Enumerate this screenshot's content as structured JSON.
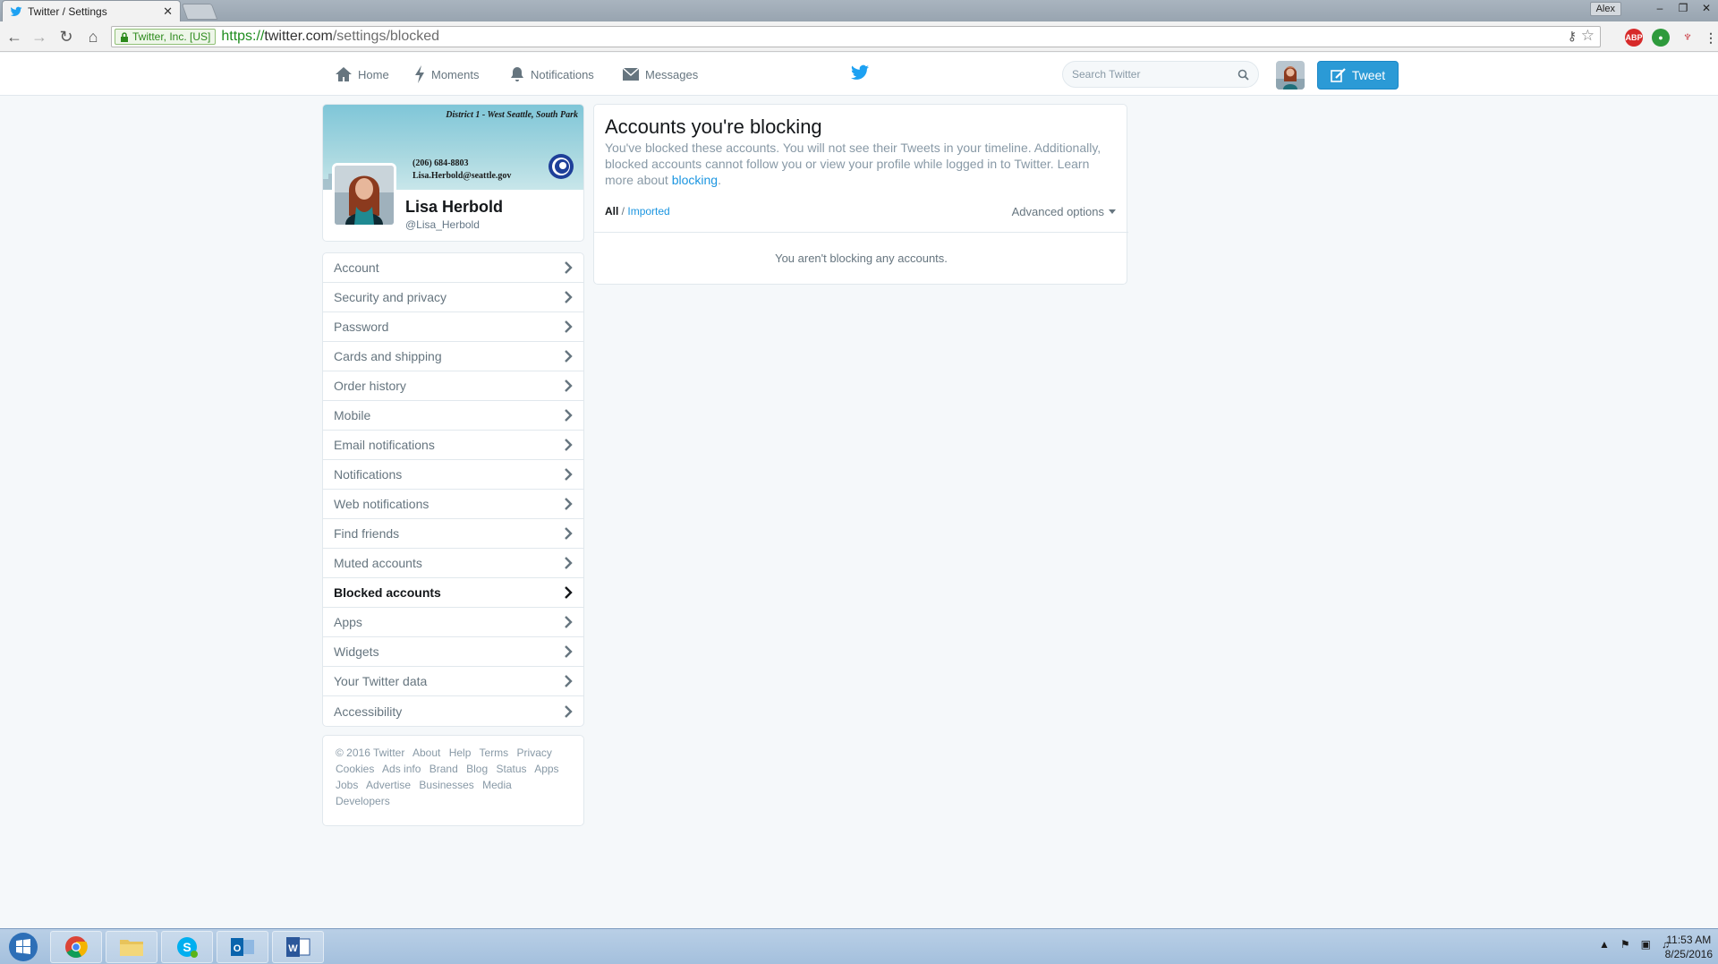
{
  "browser": {
    "tab_title": "Twitter / Settings",
    "user_label": "Alex",
    "ev_badge": "Twitter, Inc. [US]",
    "url_scheme": "https://",
    "url_host": "twitter.com",
    "url_path": "/settings/blocked",
    "ext_abp": "ABP"
  },
  "nav": {
    "home": "Home",
    "moments": "Moments",
    "notifications": "Notifications",
    "messages": "Messages",
    "search_placeholder": "Search Twitter",
    "tweet": "Tweet"
  },
  "profile": {
    "banner_line1": "District 1 - West Seattle, South Park",
    "banner_phone": "(206) 684-8803",
    "banner_email": "Lisa.Herbold@seattle.gov",
    "name": "Lisa Herbold",
    "handle": "@Lisa_Herbold"
  },
  "menu": [
    {
      "label": "Account"
    },
    {
      "label": "Security and privacy"
    },
    {
      "label": "Password"
    },
    {
      "label": "Cards and shipping"
    },
    {
      "label": "Order history"
    },
    {
      "label": "Mobile"
    },
    {
      "label": "Email notifications"
    },
    {
      "label": "Notifications"
    },
    {
      "label": "Web notifications"
    },
    {
      "label": "Find friends"
    },
    {
      "label": "Muted accounts"
    },
    {
      "label": "Blocked accounts",
      "active": true
    },
    {
      "label": "Apps"
    },
    {
      "label": "Widgets"
    },
    {
      "label": "Your Twitter data"
    },
    {
      "label": "Accessibility"
    }
  ],
  "footer": {
    "links": [
      "© 2016 Twitter",
      "About",
      "Help",
      "Terms",
      "Privacy",
      "Cookies",
      "Ads info",
      "Brand",
      "Blog",
      "Status",
      "Apps",
      "Jobs",
      "Advertise",
      "Businesses",
      "Media",
      "Developers"
    ]
  },
  "main": {
    "title": "Accounts you're blocking",
    "desc_text": "You've blocked these accounts. You will not see their Tweets in your timeline. Additionally, blocked accounts cannot follow you or view your profile while logged in to Twitter. Learn more about ",
    "desc_link": "blocking",
    "desc_end": ".",
    "filter_all": "All",
    "filter_sep": " / ",
    "filter_imported": "Imported",
    "advanced": "Advanced options",
    "empty": "You aren't blocking any accounts."
  },
  "taskbar": {
    "time": "11:53 AM",
    "date": "8/25/2016"
  },
  "colors": {
    "twitter_blue": "#1da1f2",
    "link_blue": "#1b95e0",
    "tweet_button": "#2b9ad6"
  },
  "icons": [
    "twitter-bird-icon",
    "home-icon",
    "lightning-icon",
    "bell-icon",
    "envelope-icon",
    "search-icon",
    "chevron-right-icon",
    "caret-down-icon",
    "windows-start-icon",
    "chrome-icon",
    "folder-icon",
    "skype-icon",
    "outlook-icon",
    "word-icon"
  ]
}
